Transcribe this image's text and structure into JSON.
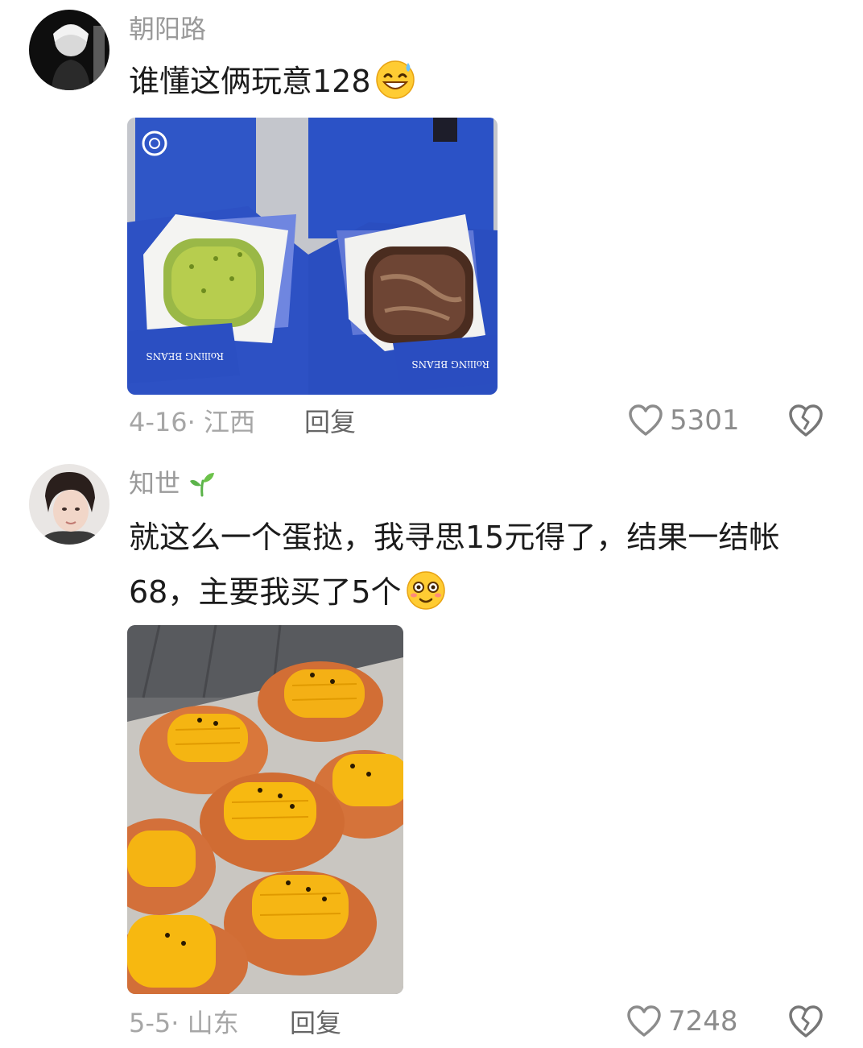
{
  "comments": [
    {
      "username": "朝阳路",
      "text": "谁懂这俩玩意128",
      "emoji": "grin-sweat-icon",
      "photo_box_text": "RolliNG BEANS",
      "meta": "4-16· 江西",
      "reply_label": "回复",
      "likes": "5301"
    },
    {
      "username": "知世",
      "badge": "sprout-icon",
      "text_line1": "就这么一个蛋挞，我寻思15元得了，结果一结帐",
      "text_line2": "68，主要我买了5个",
      "emoji": "flushed-icon",
      "meta": "5-5· 山东",
      "reply_label": "回复",
      "likes": "7248"
    }
  ]
}
